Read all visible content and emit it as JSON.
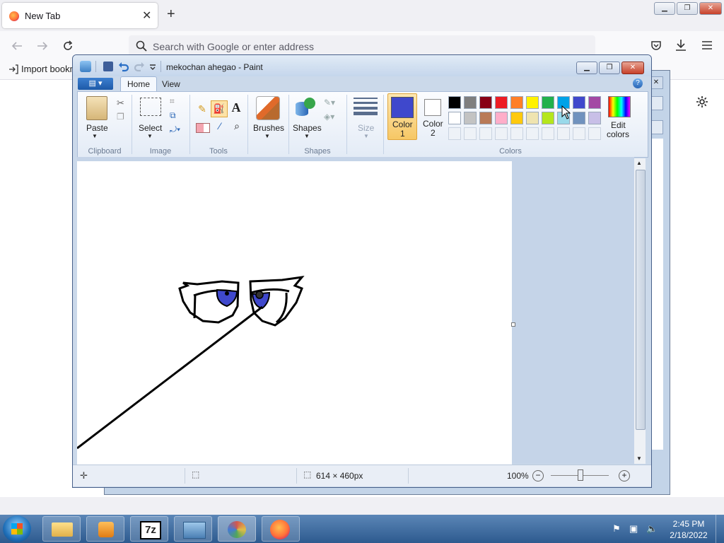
{
  "firefox": {
    "tab_title": "New Tab",
    "tab_close": "✕",
    "new_tab": "+",
    "url_placeholder": "Search with Google or enter address",
    "bookmark_import": "Import bookm",
    "icons": [
      "back-icon",
      "forward-icon",
      "reload-icon",
      "search-icon",
      "pocket-icon",
      "download-icon",
      "menu-icon",
      "settings-icon"
    ]
  },
  "window_controls": {
    "minimize": "▁",
    "restore": "❐",
    "close": "✕"
  },
  "paint": {
    "title": "mekochan ahegao - Paint",
    "tabs": {
      "home": "Home",
      "view": "View"
    },
    "groups": {
      "clipboard": "Clipboard",
      "image": "Image",
      "tools": "Tools",
      "shapes": "Shapes",
      "colors": "Colors"
    },
    "buttons": {
      "paste": "Paste",
      "select": "Select",
      "brushes": "Brushes",
      "shapes": "Shapes",
      "size": "Size",
      "color1_line1": "Color",
      "color1_line2": "1",
      "color2_line1": "Color",
      "color2_line2": "2",
      "edit_colors_line1": "Edit",
      "edit_colors_line2": "colors"
    },
    "color1": "#3f48cc",
    "color2": "#ffffff",
    "palette_row1": [
      "#000000",
      "#7f7f7f",
      "#880015",
      "#ed1c24",
      "#ff7f27",
      "#fff200",
      "#22b14c",
      "#00a2e8",
      "#3f48cc",
      "#a349a4"
    ],
    "palette_row2": [
      "#ffffff",
      "#c3c3c3",
      "#b97a57",
      "#ffaec9",
      "#ffc90e",
      "#efe4b0",
      "#b5e61d",
      "#99d9ea",
      "#7092be",
      "#c8bfe7"
    ],
    "status": {
      "dimensions": "614 × 460px",
      "zoom": "100%"
    }
  },
  "taskbar": {
    "time": "2:45 PM",
    "date": "2/18/2022",
    "items": [
      "explorer-icon",
      "media-player-icon",
      "7zip-icon",
      "photo-viewer-icon",
      "paint-icon",
      "firefox-icon"
    ],
    "zip_label": "7z"
  }
}
